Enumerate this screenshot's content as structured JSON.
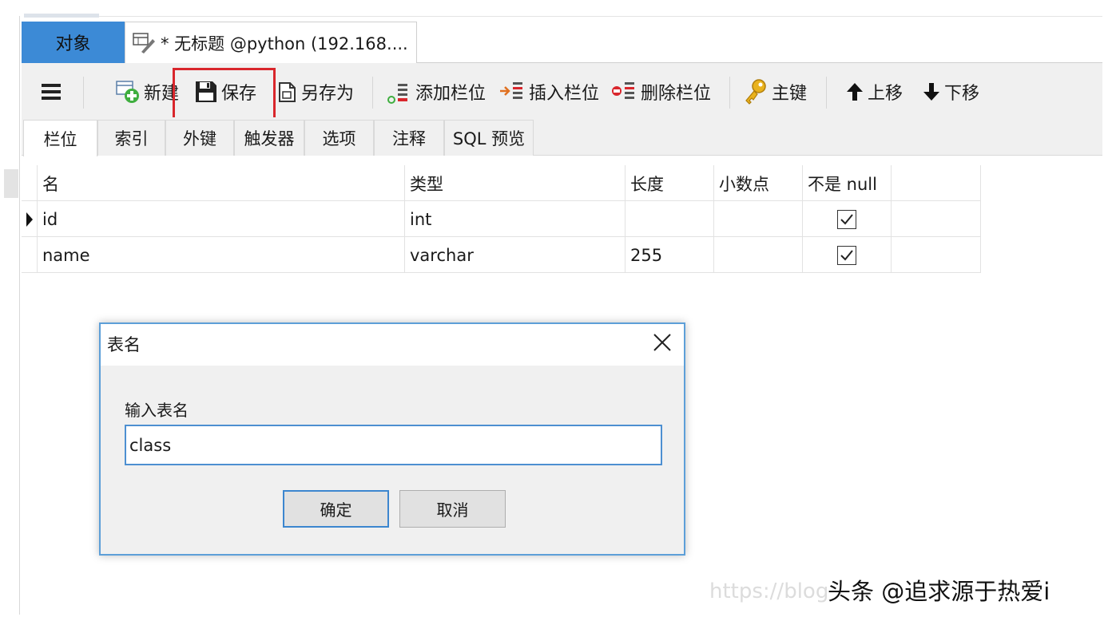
{
  "tabs": {
    "objects": "对象",
    "document": "* 无标题 @python (192.168...."
  },
  "toolbar": {
    "new": "新建",
    "save": "保存",
    "save_as": "另存为",
    "add_column": "添加栏位",
    "insert_column": "插入栏位",
    "delete_column": "删除栏位",
    "primary_key": "主键",
    "move_up": "上移",
    "move_down": "下移"
  },
  "inner_tabs": [
    "栏位",
    "索引",
    "外键",
    "触发器",
    "选项",
    "注释",
    "SQL 预览"
  ],
  "grid": {
    "headers": [
      "名",
      "类型",
      "长度",
      "小数点",
      "不是 null"
    ],
    "rows": [
      {
        "name": "id",
        "type": "int",
        "length": "",
        "decimals": "",
        "not_null": true
      },
      {
        "name": "name",
        "type": "varchar",
        "length": "255",
        "decimals": "",
        "not_null": true
      }
    ]
  },
  "dialog": {
    "title": "表名",
    "label": "输入表名",
    "value": "class",
    "ok": "确定",
    "cancel": "取消"
  },
  "watermark": "https://blog",
  "brand": "头条 @追求源于热爱i",
  "colors": {
    "active_tab": "#3c8ad6",
    "highlight": "#d9262c",
    "dialog_border": "#5d9fd8"
  }
}
